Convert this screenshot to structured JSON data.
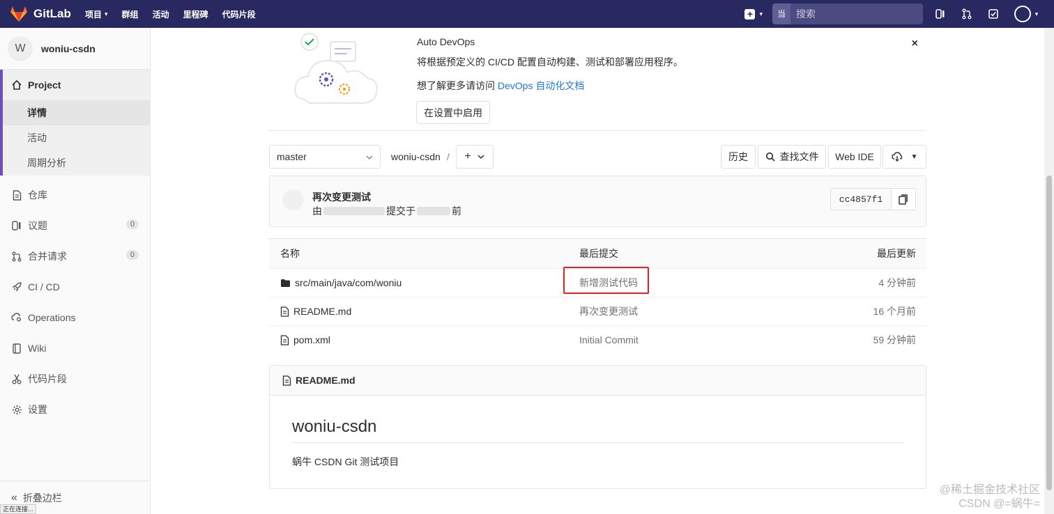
{
  "navbar": {
    "brand": "GitLab",
    "menu": [
      {
        "label": "项目",
        "caret": true
      },
      {
        "label": "群组",
        "caret": false
      },
      {
        "label": "活动",
        "caret": false
      },
      {
        "label": "里程碑",
        "caret": false
      },
      {
        "label": "代码片段",
        "caret": false
      }
    ],
    "search_scope": "当前项目",
    "search_placeholder": "搜索"
  },
  "sidebar": {
    "project_initial": "W",
    "project_name": "woniu-csdn",
    "section_label": "Project",
    "sub_items": [
      "详情",
      "活动",
      "周期分析"
    ],
    "items": [
      {
        "label": "仓库",
        "icon": "doc-icon"
      },
      {
        "label": "议题",
        "icon": "issues-icon",
        "count": "0"
      },
      {
        "label": "合并请求",
        "icon": "merge-request-icon",
        "count": "0"
      },
      {
        "label": "CI / CD",
        "icon": "rocket-icon"
      },
      {
        "label": "Operations",
        "icon": "cloud-gear-icon"
      },
      {
        "label": "Wiki",
        "icon": "book-icon"
      },
      {
        "label": "代码片段",
        "icon": "scissors-icon"
      },
      {
        "label": "设置",
        "icon": "gear-icon"
      }
    ],
    "collapse_label": "折叠边栏",
    "status_text": "正在连接..."
  },
  "devops": {
    "title": "Auto DevOps",
    "description": "将根据预定义的 CI/CD 配置自动构建、测试和部署应用程序。",
    "more_prefix": "想了解更多请访问 ",
    "more_link": "DevOps 自动化文档",
    "enable_button": "在设置中启用",
    "close": "×"
  },
  "toolbar": {
    "branch": "master",
    "path_root": "woniu-csdn",
    "path_sep": "/",
    "history": "历史",
    "find_file": "查找文件",
    "web_ide": "Web IDE"
  },
  "commit": {
    "title": "再次变更测试",
    "by": "由",
    "committed": "提交于",
    "ago": "前",
    "sha": "cc4857f1"
  },
  "files": {
    "headers": {
      "name": "名称",
      "last_commit": "最后提交",
      "last_update": "最后更新"
    },
    "rows": [
      {
        "name": "src/main/java/com/woniu",
        "type": "folder",
        "commit": "新增测试代码",
        "updated": "4 分钟前"
      },
      {
        "name": "README.md",
        "type": "file",
        "commit": "再次变更测试",
        "updated": "16 个月前"
      },
      {
        "name": "pom.xml",
        "type": "file",
        "commit": "Initial Commit",
        "updated": "59 分钟前"
      }
    ]
  },
  "readme": {
    "filename": "README.md",
    "title": "woniu-csdn",
    "text": "蜗牛 CSDN Git 测试项目"
  },
  "watermark": {
    "line1": "@稀土掘金技术社区",
    "line2": "CSDN @=蜗牛="
  },
  "colors": {
    "navbar": "#292961",
    "accent": "#6b4fbb",
    "link": "#1f78d1",
    "highlight": "#e62020"
  }
}
